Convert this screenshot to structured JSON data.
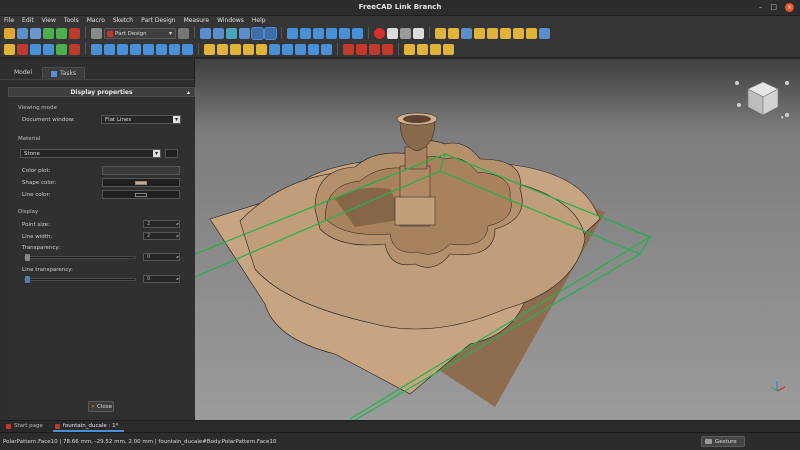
{
  "window": {
    "title": "FreeCAD Link Branch",
    "controls": [
      "–",
      "□",
      "×"
    ]
  },
  "menu": [
    "File",
    "Edit",
    "View",
    "Tools",
    "Macro",
    "Sketch",
    "Part Design",
    "Measure",
    "Windows",
    "Help"
  ],
  "toolbar": {
    "workbench": "Part Design"
  },
  "panel": {
    "tabs": [
      "Model",
      "Tasks"
    ],
    "active_tab": "Tasks",
    "title": "Display properties",
    "viewing_mode": {
      "heading": "Viewing mode",
      "document_window_label": "Document window:",
      "document_window_value": "Flat Lines"
    },
    "material": {
      "heading": "Material",
      "value": "Stone"
    },
    "colors": {
      "color_plot_label": "Color plot:",
      "shape_color_label": "Shape color:",
      "shape_color": "#d2a98a",
      "line_color_label": "Line color:",
      "line_color": "#1a1a1a"
    },
    "display": {
      "heading": "Display",
      "point_size_label": "Point size:",
      "point_size": "2",
      "line_width_label": "Line width:",
      "line_width": "2",
      "transparency_label": "Transparency:",
      "transparency": "0",
      "line_transparency_label": "Line transparency:",
      "line_transparency": "0"
    },
    "close_label": "Close"
  },
  "doc_tabs": [
    "Start page",
    "fountain_ducale : 1*"
  ],
  "active_doc": "fountain_ducale : 1*",
  "status": {
    "message": "PolarPattern.Face10 | 78.66 mm, -29.52 mm, 2.00 mm | fountain_ducale#Body.PolarPattern.Face10",
    "nav_style": "Gesture"
  },
  "colors": {
    "model": "#c8a582",
    "model_shadow": "#8e6d4f",
    "bounding_box": "#22b14c",
    "accent": "#4a90d9"
  }
}
